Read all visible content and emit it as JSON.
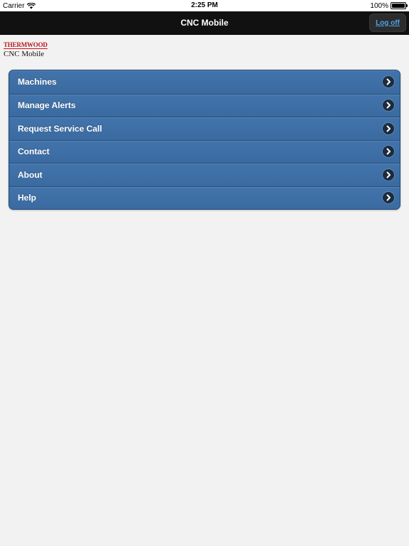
{
  "status": {
    "carrier": "Carrier",
    "time": "2:25 PM",
    "battery": "100%"
  },
  "nav": {
    "title": "CNC Mobile",
    "logoff_label": "Log off"
  },
  "logo": {
    "top": "THERMWOOD",
    "bottom": "CNC Mobile"
  },
  "menu": {
    "items": [
      {
        "label": "Machines"
      },
      {
        "label": "Manage Alerts"
      },
      {
        "label": "Request Service Call"
      },
      {
        "label": "Contact"
      },
      {
        "label": "About"
      },
      {
        "label": "Help"
      }
    ]
  },
  "colors": {
    "menu_bg": "#3d6fa6",
    "nav_bg": "#111111",
    "link": "#4da3e8",
    "logo_red": "#c0151b"
  }
}
